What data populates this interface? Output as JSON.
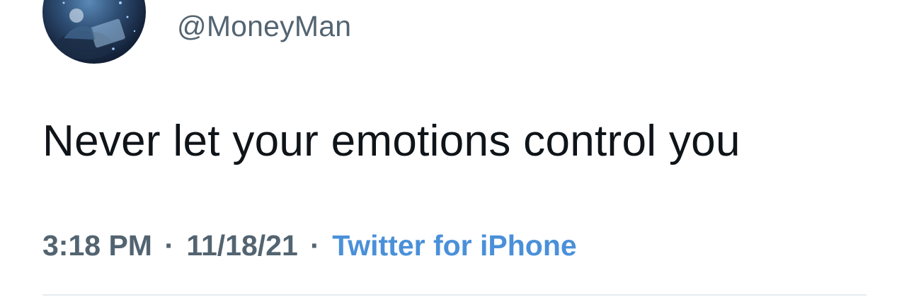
{
  "tweet": {
    "display_name": "",
    "handle": "@MoneyMan",
    "text": "Never let your emotions control you",
    "time": "3:18 PM",
    "date": "11/18/21",
    "separator": "·",
    "source": "Twitter for iPhone"
  },
  "colors": {
    "text": "#0f1419",
    "secondary": "#536471",
    "link": "#4a90d9",
    "divider": "#e6ecf0"
  },
  "icons": {
    "avatar": "user-avatar"
  }
}
